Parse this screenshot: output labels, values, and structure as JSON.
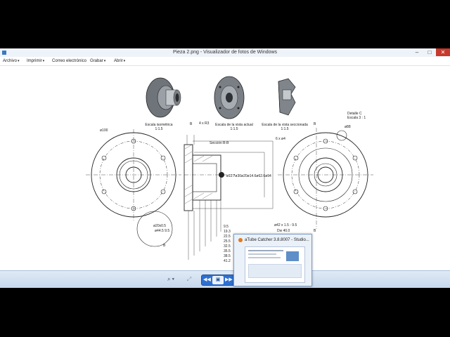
{
  "window": {
    "title": "Pieza 2.png - Visualizador de fotos de Windows",
    "minimize_glyph": "–",
    "maximize_glyph": "□",
    "close_glyph": "✕"
  },
  "menu": [
    {
      "label": "Archivo",
      "arrow": "▾"
    },
    {
      "label": "Imprimir",
      "arrow": "▾"
    },
    {
      "label": "Correo electrónico",
      "arrow": ""
    },
    {
      "label": "Grabar",
      "arrow": "▾"
    },
    {
      "label": "Abrir",
      "arrow": "▾"
    }
  ],
  "drawing": {
    "labels": {
      "iso": "Escala isométrica",
      "iso_scale": "1:1.5",
      "actual": "Escala de la vista actual",
      "actual_scale": "1:1.5",
      "section_view": "Escala de la vista seccionada",
      "section_scale": "1:1.5",
      "detail": "Detalle C",
      "detail_scale": "Escala 3 : 1",
      "section_name": "Sección B-B",
      "b_top_left": "B",
      "b_top_right": "B",
      "b_bottom_right": "B",
      "b_circle": "B"
    },
    "dims": {
      "d100": "ø100",
      "d88": "ø88",
      "r3": "4 x R3",
      "holes": "6 x ø4",
      "dia_row": "ø11.7ø30ø20ø14.6ø62.6ø94",
      "d20": "ø20x0.5",
      "d44": "ø44.5 9.5",
      "thread": "ø42 x 1.5 - 9.5",
      "pcd": "Dw 40.0",
      "stack": [
        "9.5",
        "19.3",
        "22.5",
        "25.5",
        "32.5",
        "35.5",
        "38.5",
        "41.2"
      ]
    }
  },
  "status": {
    "zoom_glyph": "⌕ ▾",
    "fit_glyph": "⤢",
    "prev_glyph": "◀◀",
    "play_glyph": "▣",
    "next_glyph": "▶▶"
  },
  "taskbar_popup": {
    "title": "aTube Catcher 3.8.8007 - Studio..."
  },
  "colors": {
    "title_bg": "#eef3f9",
    "status_bg": "#c6d7ec",
    "close_bg": "#c7392c",
    "nav_blue": "#2f6fd1"
  }
}
